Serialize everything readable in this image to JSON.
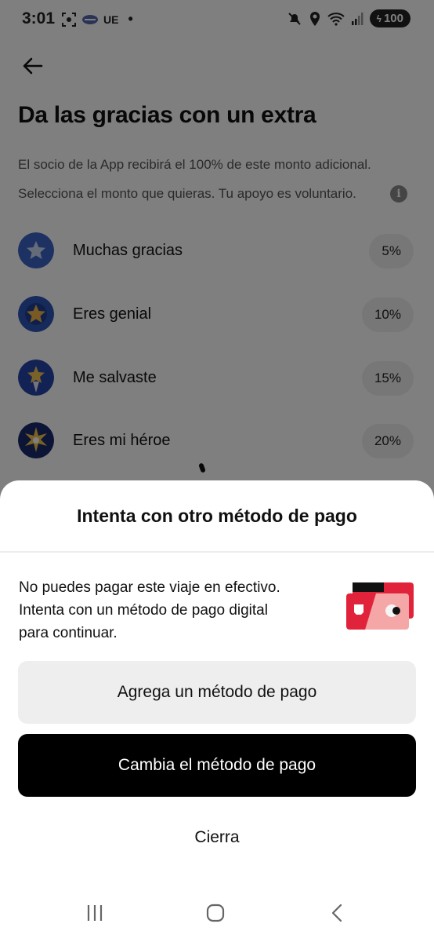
{
  "status_bar": {
    "time": "3:01",
    "carrier_text": "UE",
    "battery": "100"
  },
  "background_page": {
    "title": "Da las gracias con un extra",
    "subtitle_line1": "El socio de la App recibirá el 100% de este monto adicional.",
    "subtitle_line2": "Selecciona el monto que quieras. Tu apoyo es voluntario.",
    "tip_options": [
      {
        "label": "Muchas gracias",
        "percent": "5%",
        "icon": "star-badge-icon"
      },
      {
        "label": "Eres genial",
        "percent": "10%",
        "icon": "gold-star-badge-icon"
      },
      {
        "label": "Me salvaste",
        "percent": "15%",
        "icon": "rocket-star-badge-icon"
      },
      {
        "label": "Eres mi héroe",
        "percent": "20%",
        "icon": "burst-star-badge-icon"
      }
    ]
  },
  "sheet": {
    "title": "Intenta con otro método de pago",
    "message_line1": "No puedes pagar este viaje en efectivo.",
    "message_line2": "Intenta con un método de pago digital",
    "message_line3": "para continuar.",
    "add_button_label": "Agrega un método de pago",
    "change_button_label": "Cambia el método de pago",
    "close_button_label": "Cierra"
  },
  "colors": {
    "primary_button": "#000000",
    "secondary_button": "#eeeeee",
    "card_red": "#e0233a",
    "card_pink": "#f5a7a7"
  }
}
